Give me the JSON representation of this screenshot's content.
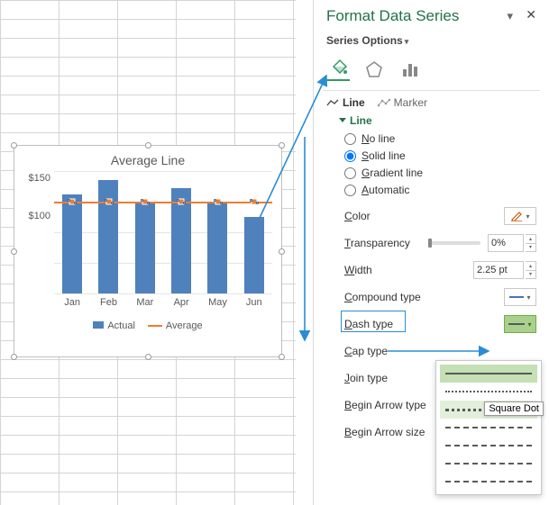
{
  "pane": {
    "title": "Format Data Series",
    "series_options_label": "Series Options",
    "subtabs": {
      "line": "Line",
      "marker": "Marker"
    },
    "section": "Line",
    "radios": {
      "none_pre": "N",
      "none_rest": "o line",
      "solid_pre": "S",
      "solid_rest": "olid line",
      "grad_pre": "G",
      "grad_rest": "radient line",
      "auto_pre": "A",
      "auto_rest": "utomatic"
    },
    "props": {
      "color_pre": "C",
      "color_rest": "olor",
      "transp_pre": "T",
      "transp_rest": "ransparency",
      "transp_val": "0%",
      "width_pre": "W",
      "width_rest": "idth",
      "width_val": "2.25 pt",
      "compound_pre": "C",
      "compound_rest": "ompound type",
      "dash_pre": "D",
      "dash_rest": "ash type",
      "cap_pre": "C",
      "cap_rest": "ap type",
      "join_pre": "J",
      "join_rest": "oin type",
      "begin_arrow_type_pre": "B",
      "begin_arrow_type_rest": "egin Arrow type",
      "begin_arrow_size_pre": "B",
      "begin_arrow_size_rest": "egin Arrow size"
    },
    "tooltip": "Square Dot",
    "accent_color": "#217346",
    "dash_menu_selected_index": 0,
    "dash_menu_hover_index": 2
  },
  "chart": {
    "title": "Average Line",
    "ylabs": [
      "$150",
      "$100"
    ],
    "legend": {
      "actual": "Actual",
      "average": "Average"
    }
  },
  "chart_data": {
    "type": "bar",
    "title": "Average Line",
    "categories": [
      "Jan",
      "Feb",
      "Mar",
      "Apr",
      "May",
      "Jun"
    ],
    "series": [
      {
        "name": "Actual",
        "type": "bar",
        "values": [
          130,
          148,
          120,
          138,
          120,
          100
        ],
        "color": "#4f81bd"
      },
      {
        "name": "Average",
        "type": "line",
        "values": [
          120,
          120,
          120,
          120,
          120,
          120
        ],
        "color": "#ed7d31"
      }
    ],
    "ylabel": "",
    "xlabel": "",
    "ylim": [
      0,
      160
    ],
    "yticks_labeled": [
      100,
      150
    ]
  }
}
